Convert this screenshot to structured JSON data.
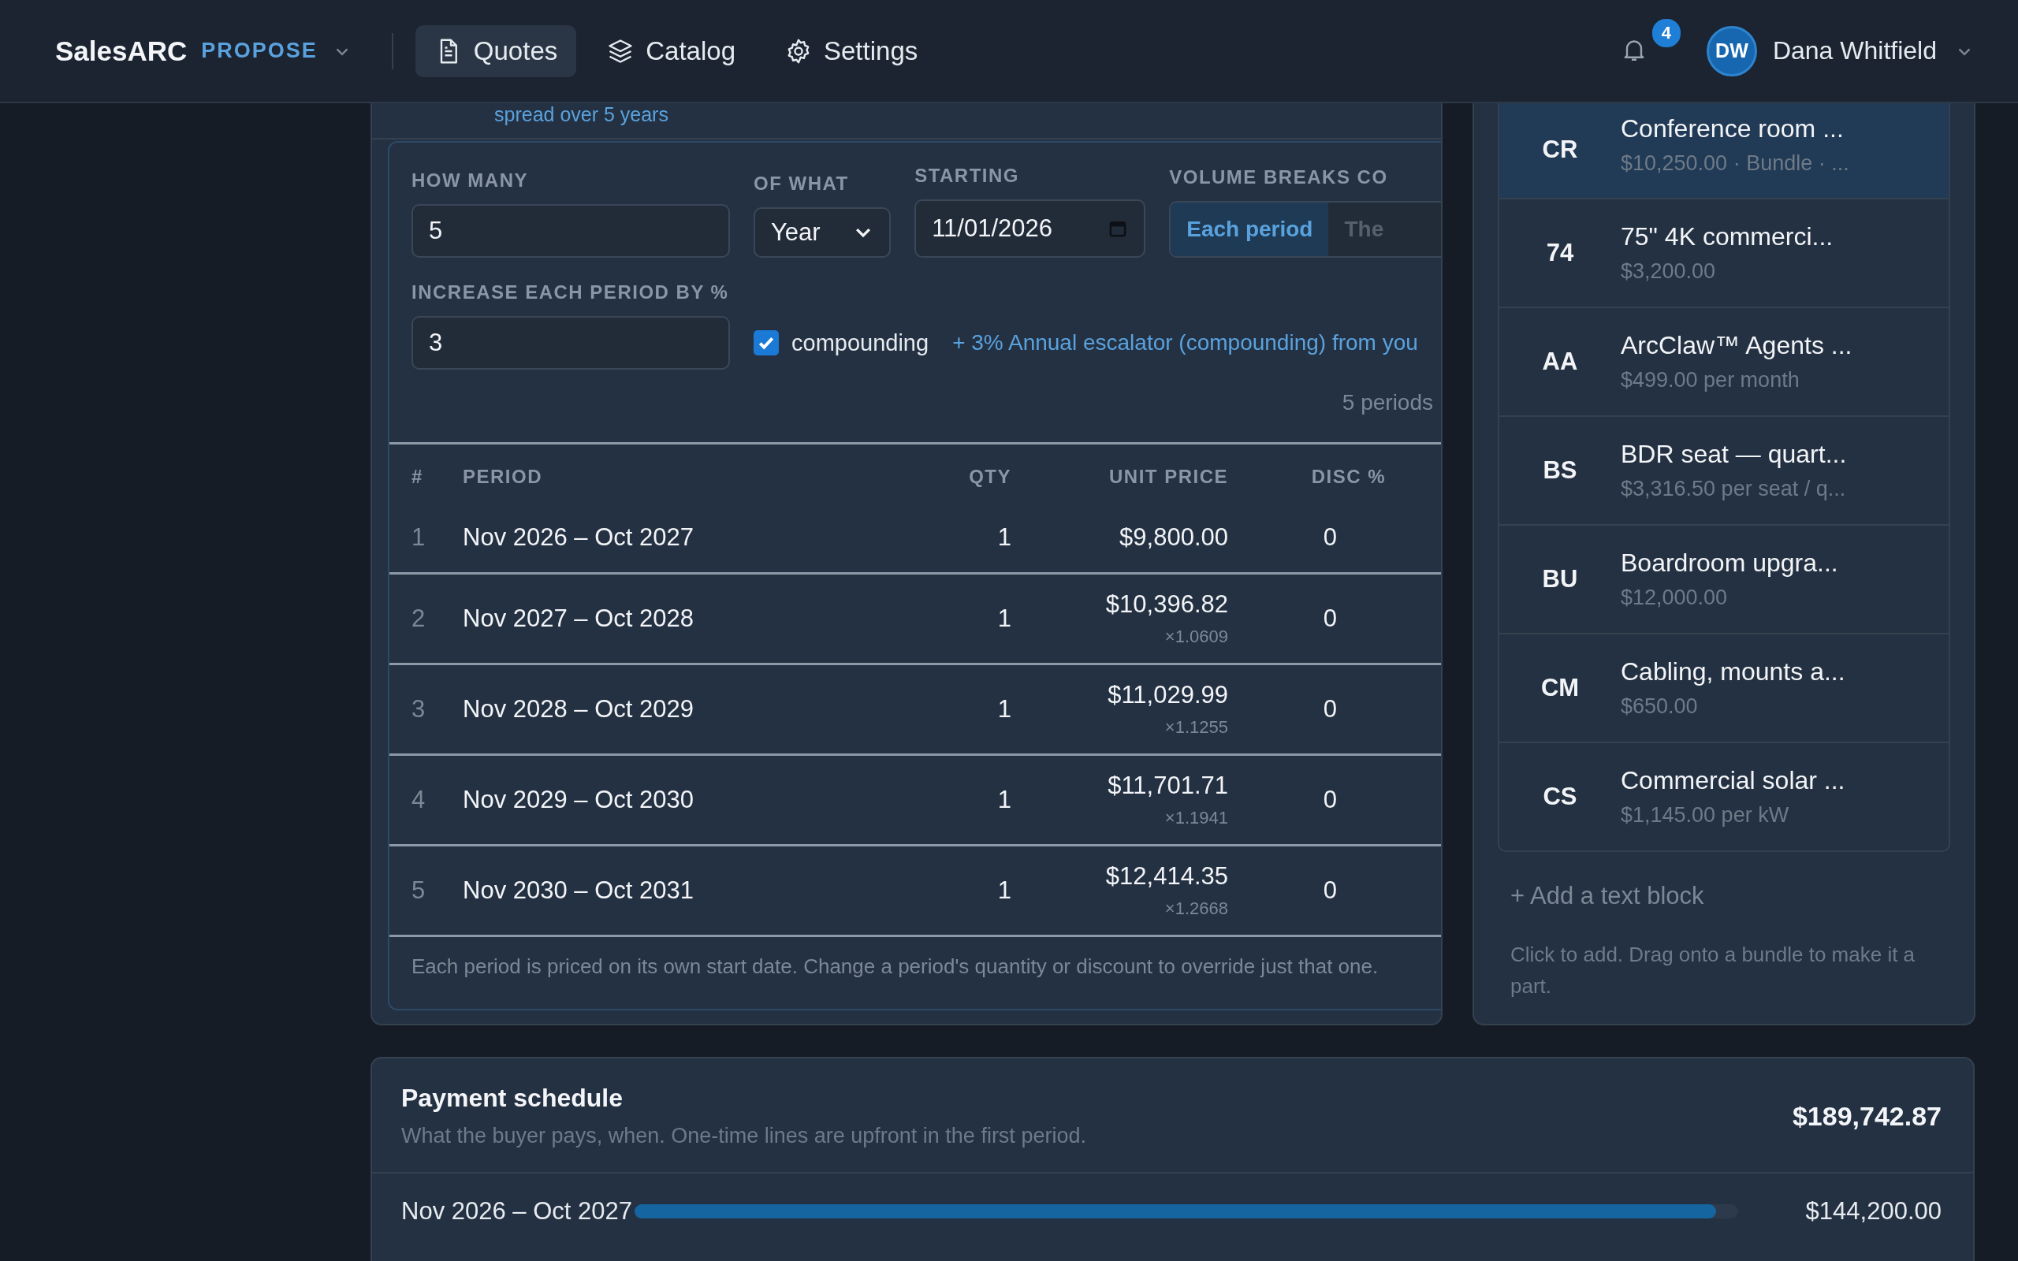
{
  "header": {
    "brand": "SalesARC",
    "product": "PROPOSE",
    "nav": [
      {
        "label": "Quotes",
        "selected": true
      },
      {
        "label": "Catalog",
        "selected": false
      },
      {
        "label": "Settings",
        "selected": false
      }
    ],
    "notifications": "4",
    "user": {
      "initials": "DW",
      "name": "Dana Whitfield"
    }
  },
  "escalation": {
    "note": "spread over 5 years",
    "how_many": {
      "label": "HOW MANY",
      "value": "5"
    },
    "of_what": {
      "label": "OF WHAT",
      "value": "Year"
    },
    "starting": {
      "label": "STARTING",
      "value": "11/01/2026"
    },
    "volume_breaks": {
      "label": "VOLUME BREAKS CO",
      "options": [
        {
          "label": "Each period",
          "selected": true
        },
        {
          "label": "The",
          "selected": false
        }
      ]
    },
    "increase": {
      "label": "INCREASE EACH PERIOD BY %",
      "value": "3"
    },
    "compounding": {
      "label": "compounding",
      "checked": true
    },
    "summary": "+ 3% Annual escalator (compounding) from you",
    "periods_count": "5 periods",
    "table": {
      "columns": [
        "#",
        "PERIOD",
        "QTY",
        "UNIT PRICE",
        "DISC %"
      ],
      "rows": [
        {
          "index": "1",
          "period": "Nov 2026 – Oct 2027",
          "qty": "1",
          "unit_price": "$9,800.00",
          "disc": "0"
        },
        {
          "index": "2",
          "period": "Nov 2027 – Oct 2028",
          "qty": "1",
          "unit_price": "$10,396.82",
          "factor": "×1.0609",
          "disc": "0"
        },
        {
          "index": "3",
          "period": "Nov 2028 – Oct 2029",
          "qty": "1",
          "unit_price": "$11,029.99",
          "factor": "×1.1255",
          "disc": "0"
        },
        {
          "index": "4",
          "period": "Nov 2029 – Oct 2030",
          "qty": "1",
          "unit_price": "$11,701.71",
          "factor": "×1.1941",
          "disc": "0"
        },
        {
          "index": "5",
          "period": "Nov 2030 – Oct 2031",
          "qty": "1",
          "unit_price": "$12,414.35",
          "factor": "×1.2668",
          "disc": "0"
        }
      ]
    },
    "footnote": "Each period is priced on its own start date. Change a period's quantity or discount to override just that one."
  },
  "catalog": {
    "items": [
      {
        "initials": "CR",
        "name": "Conference room ...",
        "detail": "$10,250.00 · Bundle · ...",
        "selected": true
      },
      {
        "initials": "74",
        "name": "75\" 4K commerci...",
        "detail": "$3,200.00",
        "selected": false
      },
      {
        "initials": "AA",
        "name": "ArcClaw™ Agents ...",
        "detail": "$499.00 per month",
        "selected": false
      },
      {
        "initials": "BS",
        "name": "BDR seat — quart...",
        "detail": "$3,316.50 per seat / q...",
        "selected": false
      },
      {
        "initials": "BU",
        "name": "Boardroom upgra...",
        "detail": "$12,000.00",
        "selected": false
      },
      {
        "initials": "CM",
        "name": "Cabling, mounts a...",
        "detail": "$650.00",
        "selected": false
      },
      {
        "initials": "CS",
        "name": "Commercial solar ...",
        "detail": "$1,145.00 per kW",
        "selected": false
      }
    ],
    "add_text_block": "+ Add a text block",
    "hint": "Click to add. Drag onto a bundle to make it a part."
  },
  "payment_schedule": {
    "title": "Payment schedule",
    "subtitle": "What the buyer pays, when. One-time lines are upfront in the first period.",
    "total": "$189,742.87",
    "rows": [
      {
        "period": "Nov 2026 – Oct 2027",
        "level": 0.98,
        "amount": "$144,200.00"
      }
    ]
  }
}
